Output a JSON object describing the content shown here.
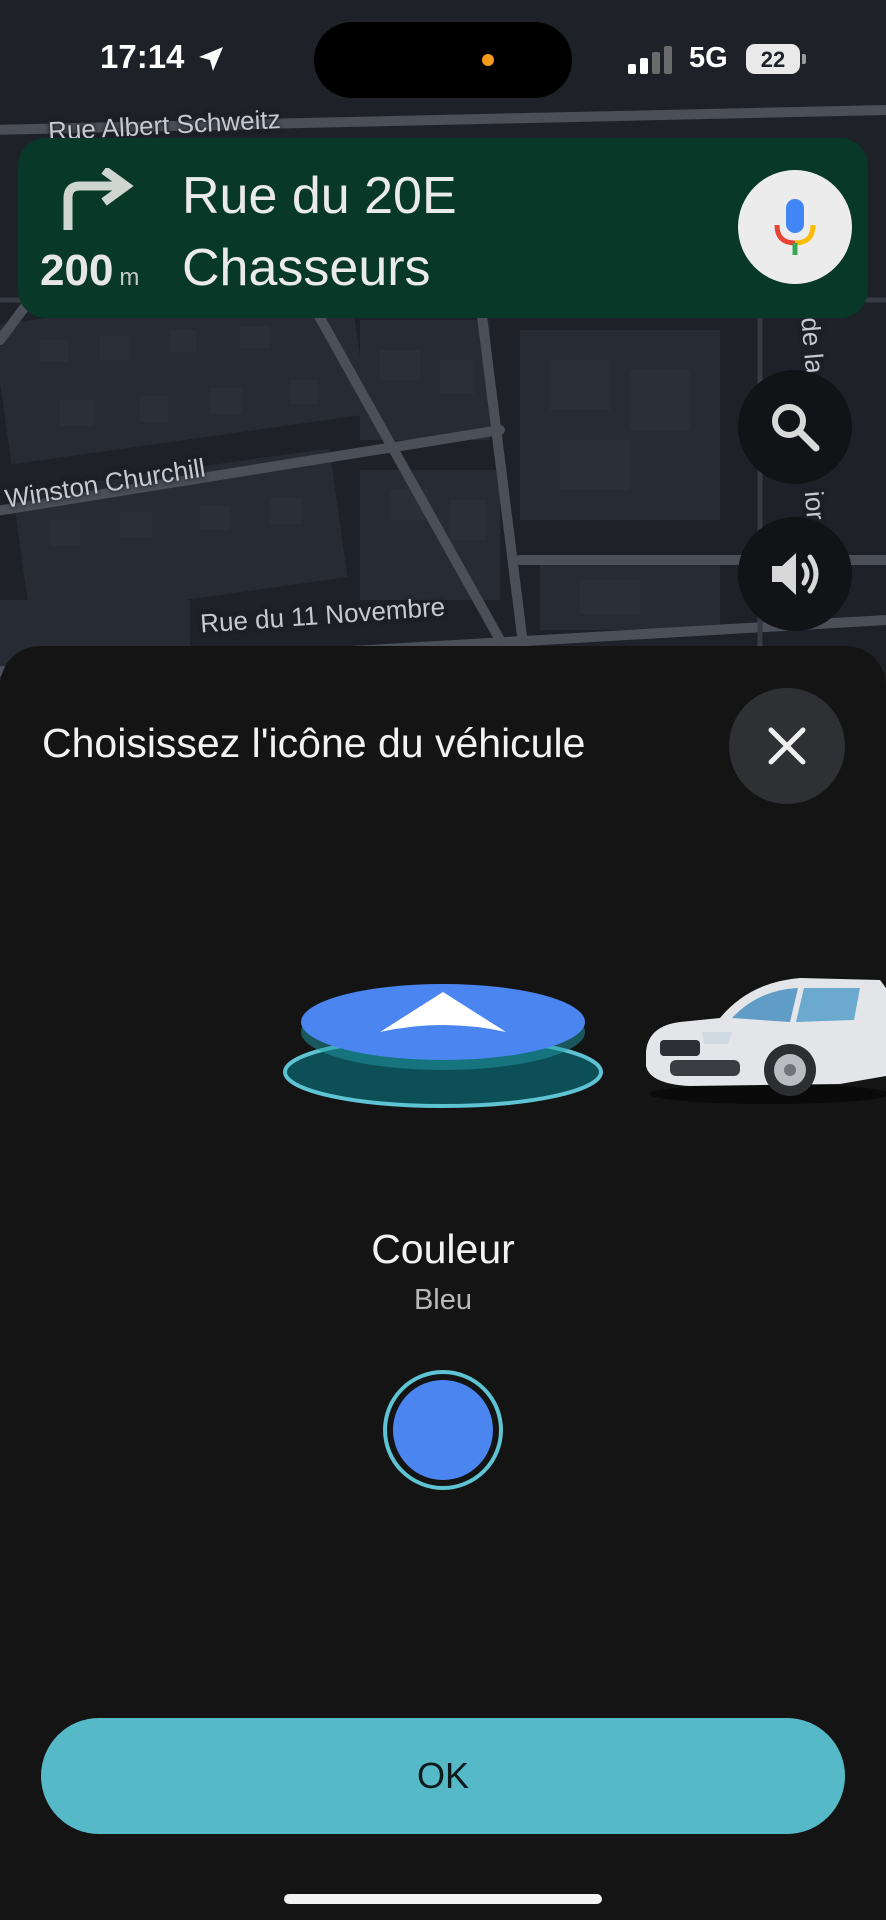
{
  "status_bar": {
    "time": "17:14",
    "network": "5G",
    "battery_level": "22"
  },
  "map": {
    "street_labels": [
      "Rue Albert Schweitz",
      "Winston Churchill",
      "Rue du 11 Novembre",
      "de la",
      "ior"
    ]
  },
  "navigation": {
    "maneuver_icon": "turn-right-icon",
    "distance_value": "200",
    "distance_unit": "m",
    "street_line1": "Rue du 20E",
    "street_line2": "Chasseurs",
    "banner_color": "#073828"
  },
  "map_buttons": {
    "voice_search_icon": "microphone-icon",
    "search_icon": "search-icon",
    "sound_icon": "volume-icon"
  },
  "sheet": {
    "title": "Choisissez l'icône du véhicule",
    "close_icon": "close-icon",
    "vehicle_options": [
      {
        "icon": "navigation-arrow-icon",
        "selected": true
      },
      {
        "icon": "car-icon",
        "selected": false
      }
    ],
    "color_heading": "Couleur",
    "color_value": "Bleu",
    "selected_color": "#4a85f0",
    "ok_label": "OK",
    "accent_color": "#56b9c8"
  }
}
